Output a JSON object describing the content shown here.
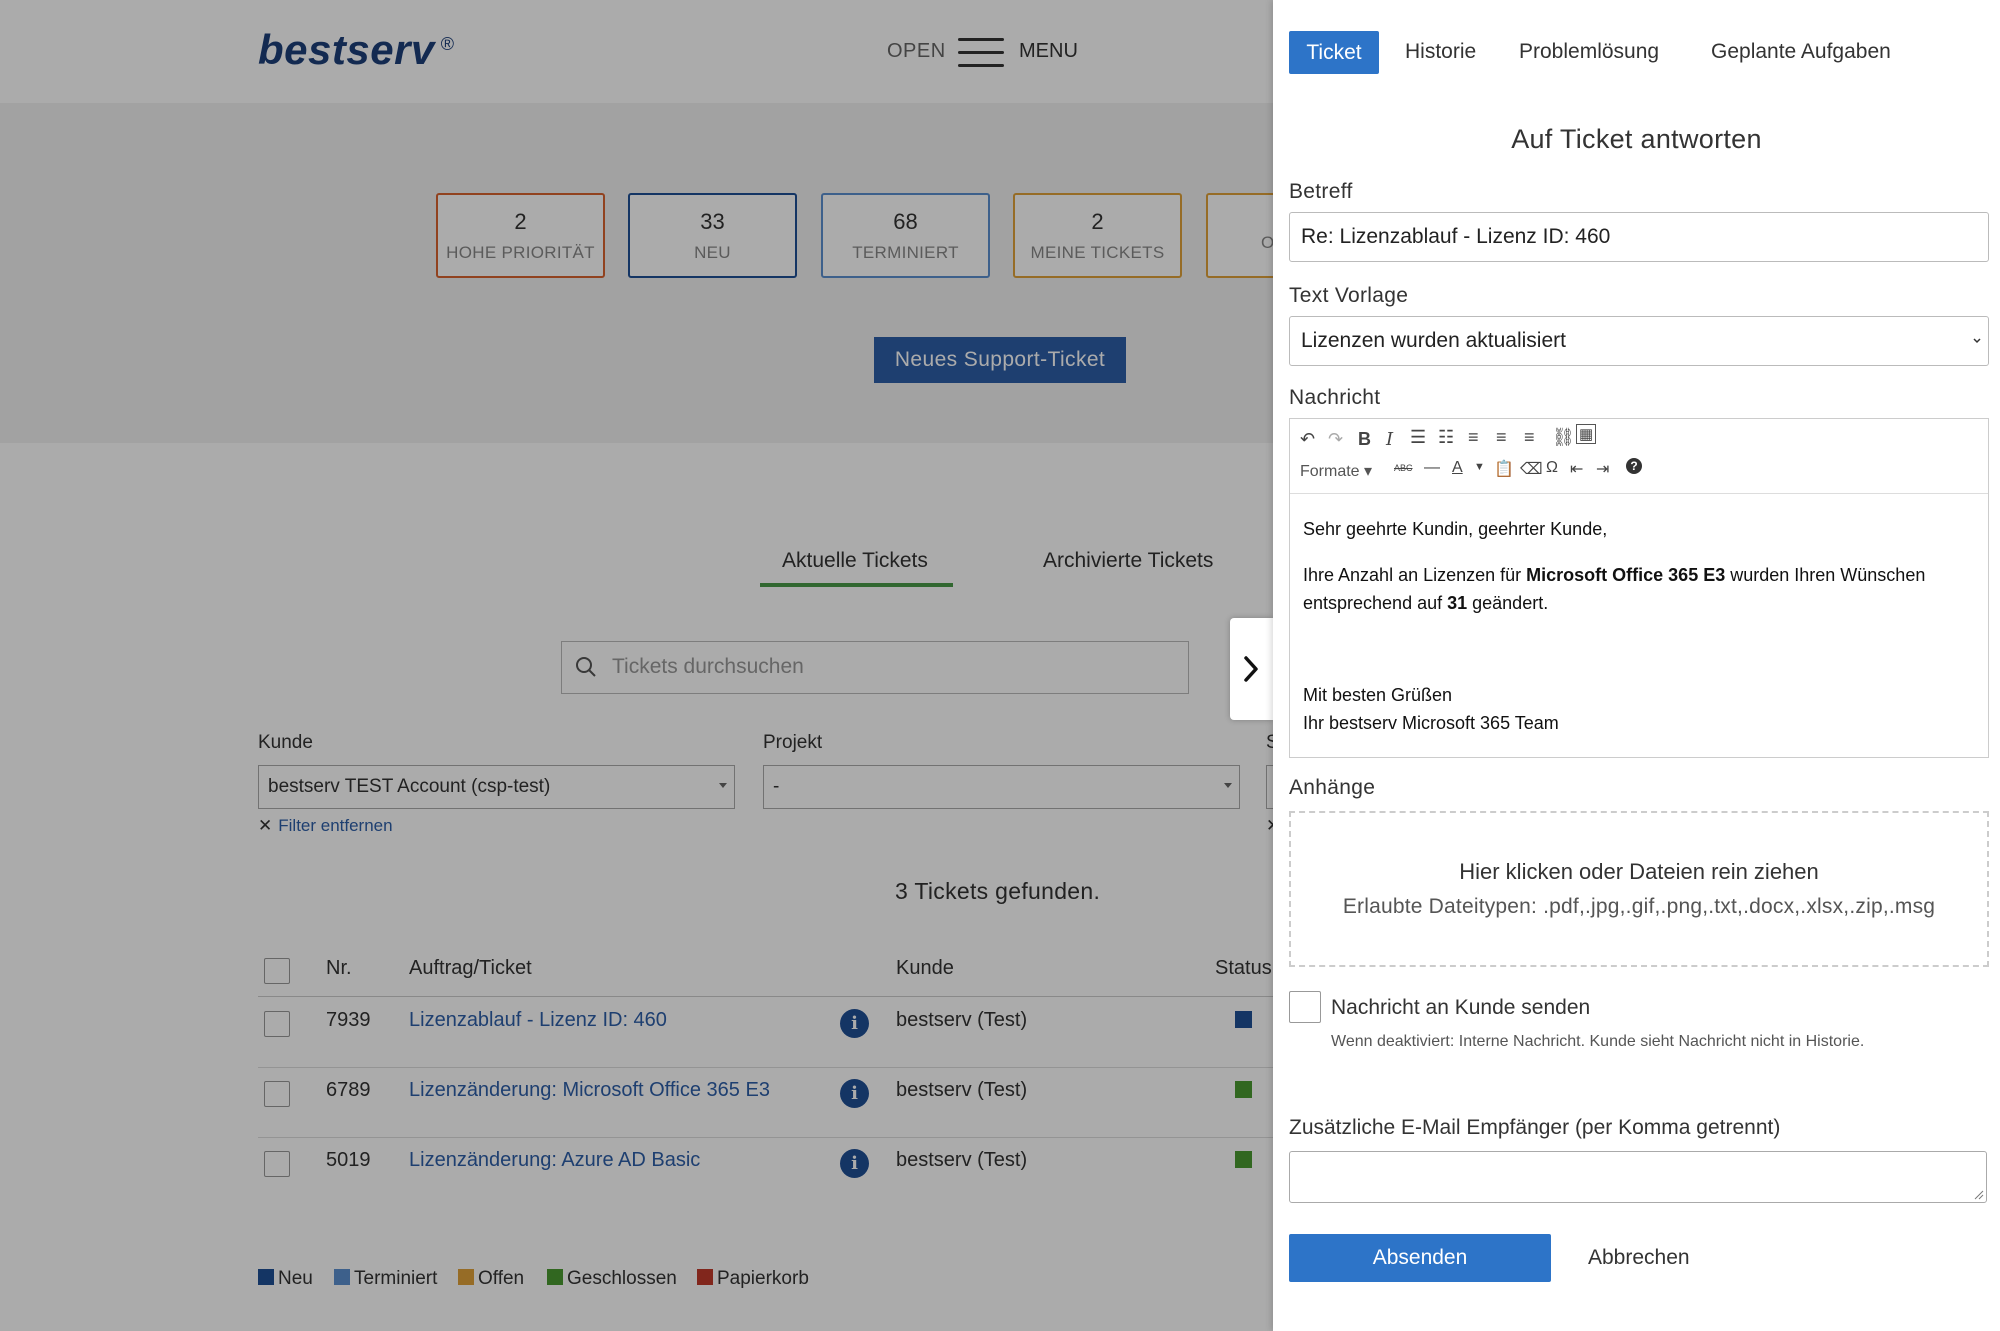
{
  "header": {
    "logo": "bestserv",
    "logo_mark": "®",
    "open_label": "OPEN",
    "menu_label": "MENU"
  },
  "stats": [
    {
      "count": "2",
      "label": "HOHE PRIORITÄT",
      "color": "#d9632f"
    },
    {
      "count": "33",
      "label": "NEU",
      "color": "#1f4f96"
    },
    {
      "count": "68",
      "label": "TERMINIERT",
      "color": "#5b8fd0"
    },
    {
      "count": "2",
      "label": "MEINE TICKETS",
      "color": "#e0a23a"
    },
    {
      "count": "",
      "label": "O",
      "color": "#e0a23a"
    }
  ],
  "new_ticket_button": "Neues Support-Ticket",
  "tabs": {
    "current": "Aktuelle Tickets",
    "archived": "Archivierte Tickets"
  },
  "search": {
    "placeholder": "Tickets durchsuchen"
  },
  "filters": {
    "kunde_label": "Kunde",
    "kunde_value": "bestserv TEST Account (csp-test)",
    "projekt_label": "Projekt",
    "projekt_value": "-",
    "third_label": "S",
    "remove_filter": "Filter entfernen"
  },
  "results_text": "3 Tickets gefunden.",
  "table": {
    "headers": {
      "nr": "Nr.",
      "ticket": "Auftrag/Ticket",
      "kunde": "Kunde",
      "status": "Status"
    },
    "rows": [
      {
        "nr": "7939",
        "ticket": "Lizenzablauf - Lizenz ID: 460",
        "kunde": "bestserv (Test)",
        "status_color": "#1f4f96"
      },
      {
        "nr": "6789",
        "ticket": "Lizenzänderung: Microsoft Office 365 E3",
        "kunde": "bestserv (Test)",
        "status_color": "#4a9a30"
      },
      {
        "nr": "5019",
        "ticket": "Lizenzänderung: Azure AD Basic",
        "kunde": "bestserv (Test)",
        "status_color": "#4a9a30"
      }
    ]
  },
  "legend": [
    {
      "label": "Neu",
      "color": "#1f4f96"
    },
    {
      "label": "Terminiert",
      "color": "#5b8fd0"
    },
    {
      "label": "Offen",
      "color": "#e0a23a"
    },
    {
      "label": "Geschlossen",
      "color": "#4a9a30"
    },
    {
      "label": "Papierkorb",
      "color": "#c0392b"
    }
  ],
  "panel": {
    "tabs": [
      "Ticket",
      "Historie",
      "Problemlösung",
      "Geplante Aufgaben"
    ],
    "title": "Auf Ticket antworten",
    "subject_label": "Betreff",
    "subject_value": "Re: Lizenzablauf - Lizenz ID: 460",
    "template_label": "Text Vorlage",
    "template_value": "Lizenzen wurden aktualisiert",
    "message_label": "Nachricht",
    "toolbar_formats": "Formate",
    "message": {
      "greeting": "Sehr geehrte Kundin, geehrter Kunde,",
      "p1_a": "Ihre Anzahl an Lizenzen für ",
      "p1_bold": "Microsoft Office 365 E3",
      "p1_b": " wurden Ihren Wünschen",
      "p2_a": "entsprechend auf ",
      "p2_bold": "31",
      "p2_b": " geändert.",
      "closing": "Mit besten Grüßen",
      "signature": "Ihr bestserv Microsoft 365 Team"
    },
    "attachments_label": "Anhänge",
    "dropzone_line1": "Hier klicken oder Dateien rein ziehen",
    "dropzone_line2": "Erlaubte Dateitypen: .pdf,.jpg,.gif,.png,.txt,.docx,.xlsx,.zip,.msg",
    "send_to_customer_label": "Nachricht an Kunde senden",
    "send_to_customer_hint": "Wenn deaktiviert: Interne Nachricht. Kunde sieht Nachricht nicht in Historie.",
    "extra_email_label": "Zusätzliche E-Mail Empfänger (per Komma getrennt)",
    "submit_label": "Absenden",
    "cancel_label": "Abbrechen"
  }
}
